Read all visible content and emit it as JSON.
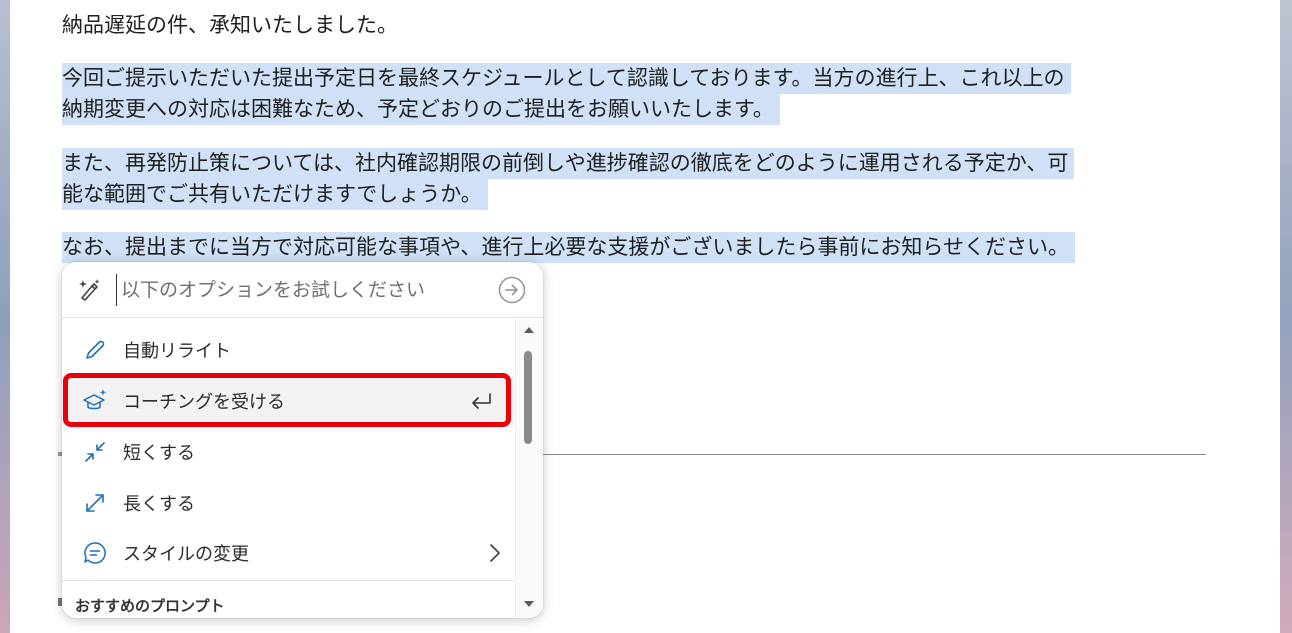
{
  "document": {
    "para1": "納品遅延の件、承知いたしました。",
    "para2_line1": "今回ご提示いただいた提出予定日を最終スケジュールとして認識しております。当方の進行上、これ以上の",
    "para2_line2": "納期変更への対応は困難なため、予定どおりのご提出をお願いいたします。",
    "para3_line1": "また、再発防止策については、社内確認期限の前倒しや進捗確認の徹底をどのように運用される予定か、可",
    "para3_line2": "能な範囲でご共有いただけますでしょうか。",
    "para4": "なお、提出までに当方で対応可能な事項や、進行上必要な支援がございましたら事前にお知らせください。"
  },
  "copilot_panel": {
    "prompt_placeholder": "以下のオプションをお試しください",
    "menu_items": [
      {
        "label": "自動リライト",
        "icon": "pen-icon"
      },
      {
        "label": "コーチングを受ける",
        "icon": "graduation-cap-sparkle-icon",
        "trailing_icon": "enter-icon",
        "highlighted": true
      },
      {
        "label": "短くする",
        "icon": "shrink-arrows-icon"
      },
      {
        "label": "長くする",
        "icon": "expand-arrows-icon"
      },
      {
        "label": "スタイルの変更",
        "icon": "chat-bubble-icon",
        "trailing_icon": "chevron-right-icon"
      }
    ],
    "section_label": "おすすめのプロンプト"
  },
  "colors": {
    "selection": "#cfe0f7",
    "focus_ring": "#e8000b",
    "icon_blue": "#1f6fb5"
  }
}
